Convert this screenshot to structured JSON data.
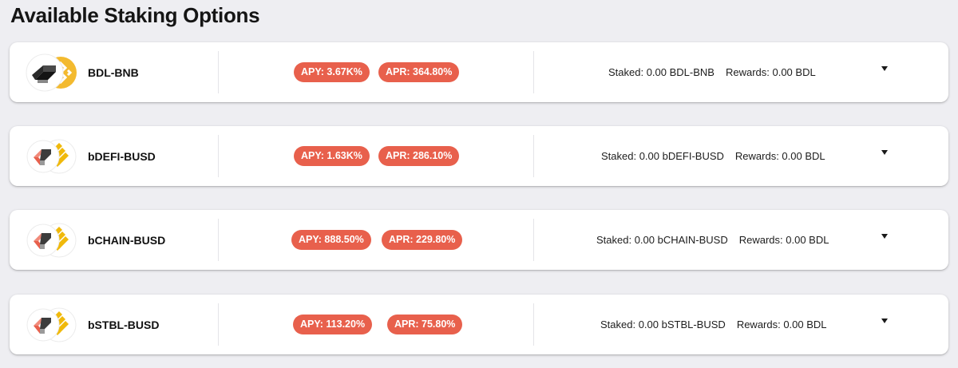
{
  "page": {
    "title": "Available Staking Options"
  },
  "colors": {
    "badge": "#e8604c",
    "bnb_yellow": "#f3ba2f",
    "busd_yellow": "#f0b90b"
  },
  "pools": [
    {
      "name": "BDL-BNB",
      "logo_icon": "bdl-bnb-pair-icon",
      "apy": "APY: 3.67K%",
      "apr": "APR: 364.80%",
      "staked": "Staked: 0.00 BDL-BNB",
      "rewards": "Rewards: 0.00 BDL"
    },
    {
      "name": "bDEFI-BUSD",
      "logo_icon": "bdefi-busd-pair-icon",
      "apy": "APY: 1.63K%",
      "apr": "APR: 286.10%",
      "staked": "Staked: 0.00 bDEFI-BUSD",
      "rewards": "Rewards: 0.00 BDL"
    },
    {
      "name": "bCHAIN-BUSD",
      "logo_icon": "bchain-busd-pair-icon",
      "apy": "APY: 888.50%",
      "apr": "APR: 229.80%",
      "staked": "Staked: 0.00 bCHAIN-BUSD",
      "rewards": "Rewards: 0.00 BDL"
    },
    {
      "name": "bSTBL-BUSD",
      "logo_icon": "bstbl-busd-pair-icon",
      "apy": "APY: 113.20%",
      "apr": "APR: 75.80%",
      "staked": "Staked: 0.00 bSTBL-BUSD",
      "rewards": "Rewards: 0.00 BDL"
    }
  ]
}
